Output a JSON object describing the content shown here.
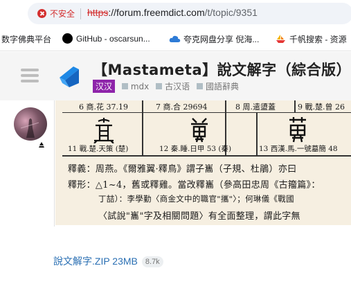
{
  "browser": {
    "security_label": "不安全",
    "url_protocol": "https",
    "url_separator": "://",
    "url_host": "forum.freemdict.com",
    "url_path": "/t/topic/9351"
  },
  "bookmarks": [
    {
      "label": "数字佛典平台",
      "icon": "none"
    },
    {
      "label": "GitHub - oscarsun...",
      "icon": "github-icon"
    },
    {
      "label": "夸克网盘分享 倪海...",
      "icon": "cloud-icon"
    },
    {
      "label": "千帆搜索 - 资源",
      "icon": "ship-icon"
    }
  ],
  "topic": {
    "title": "【Mastameta】說文解字（綜合版）",
    "category": "汉汉",
    "tags": [
      "mdx",
      "古汉语",
      "國語辭典"
    ],
    "category_color": "#8e24aa"
  },
  "post": {
    "attachment_name": "說文解字.ZIP 23MB",
    "attachment_count": "8.7k"
  },
  "scan": {
    "top_cells": [
      "6 商.花 37.19",
      "7 商.合 29694",
      "8 周.遣盨蓋",
      "9 戰.楚.曾 26"
    ],
    "bottom_cells": [
      "11 戰.楚.天策 (楚)",
      "12 秦.睡.日甲 53 (秦)",
      "13 西漢.馬.一號墓簡 48"
    ],
    "lines": [
      "釋義：周燕。《爾雅翼·釋鳥》謂子巂（子規、杜鵑）亦曰",
      "釋形：△1~4，舊或釋雞。當改釋巂（參高田忠周《古籀篇》：",
      "丁喆）：李學勤〈商金文中的職官\"攜\"〉；何琳儀《戰國",
      "〈試說\"巂\"字及相關問題〉有全面整理，謂此字無"
    ]
  }
}
